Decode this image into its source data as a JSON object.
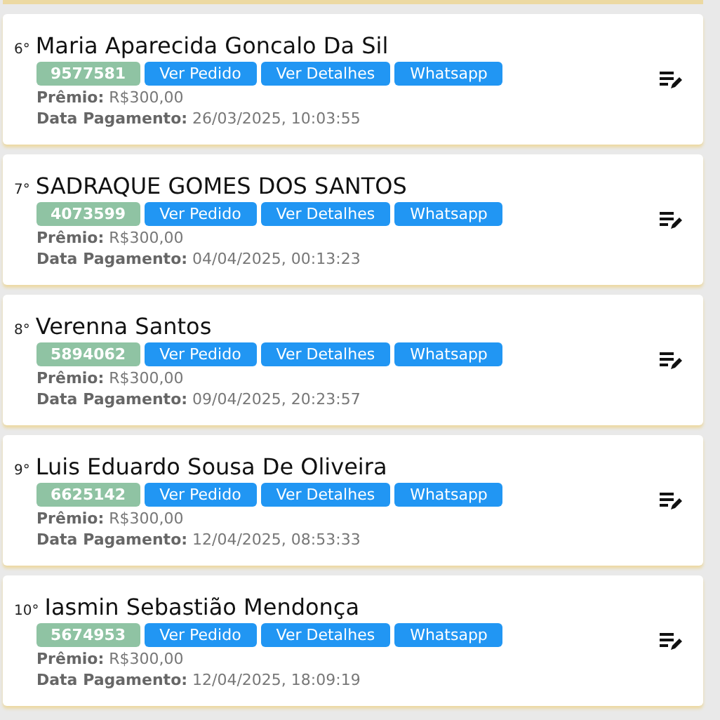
{
  "entries": [
    {
      "rank": "6°",
      "name": "Maria Aparecida Goncalo Da Sil",
      "code": "9577581",
      "buttons": [
        "Ver Pedido",
        "Ver Detalhes",
        "Whatsapp"
      ],
      "prize": "**Prêmio:** R$300,00",
      "payment": "**Data Pagamento:** 26/03/2025, 10:03:55"
    },
    {
      "rank": "7°",
      "name": "SADRAQUE GOMES DOS SANTOS",
      "code": "4073599",
      "buttons": [
        "Ver Pedido",
        "Ver Detalhes",
        "Whatsapp"
      ],
      "prize": "**Prêmio:** R$300,00",
      "payment": "**Data Pagamento:** 04/04/2025, 00:13:23"
    },
    {
      "rank": "8°",
      "name": "Verenna Santos",
      "code": "5894062",
      "buttons": [
        "Ver Pedido",
        "Ver Detalhes",
        "Whatsapp"
      ],
      "prize": "**Prêmio:** R$300,00",
      "payment": "**Data Pagamento:** 09/04/2025, 20:23:57"
    },
    {
      "rank": "9°",
      "name": "Luis Eduardo Sousa De Oliveira",
      "code": "6625142",
      "buttons": [
        "Ver Pedido",
        "Ver Detalhes",
        "Whatsapp"
      ],
      "prize": "**Prêmio:** R$300,00",
      "payment": "**Data Pagamento:** 12/04/2025, 08:53:33"
    },
    {
      "rank": "10°",
      "name": "Iasmin Sebastião Mendonça",
      "code": "5674953",
      "buttons": [
        "Ver Pedido",
        "Ver Detalhes",
        "Whatsapp"
      ],
      "prize": "**Prêmio:** R$300,00",
      "payment": "**Data Pagamento:** 12/04/2025, 18:09:19"
    }
  ]
}
